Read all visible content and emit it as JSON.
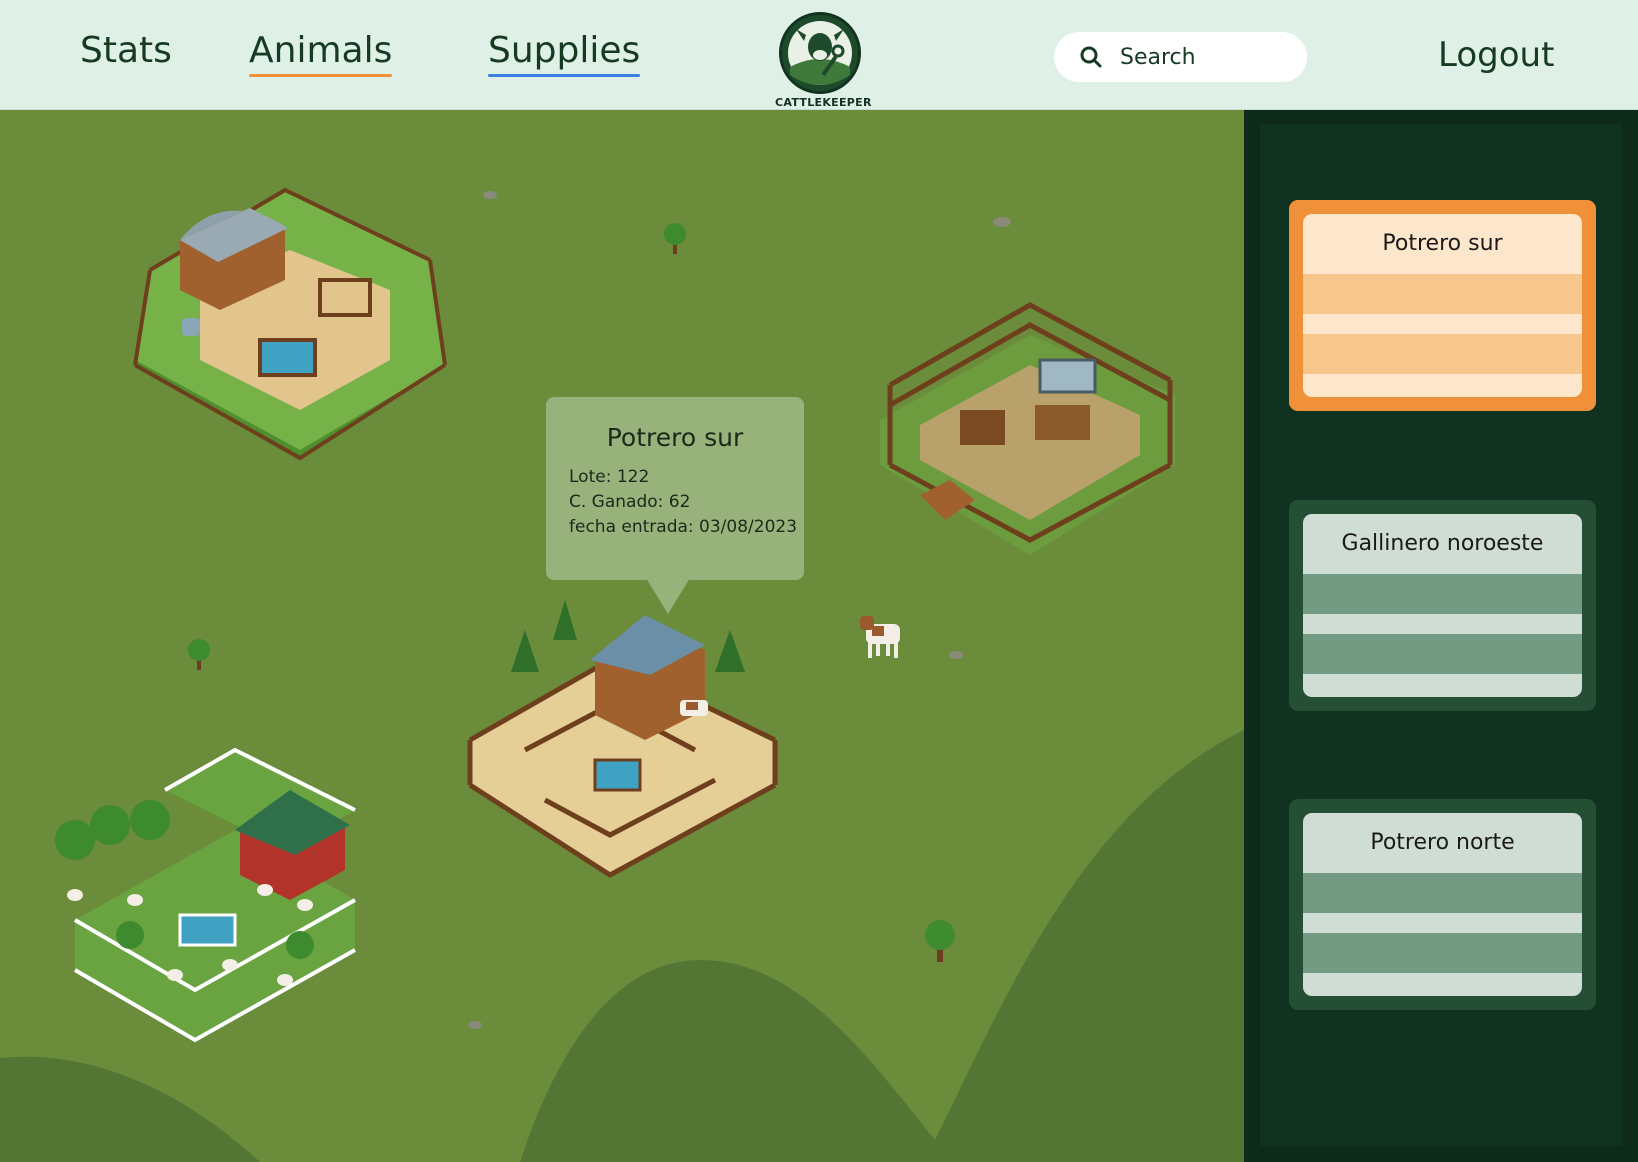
{
  "nav": {
    "stats": "Stats",
    "animals": "Animals",
    "supplies": "Supplies",
    "logout": "Logout"
  },
  "logo": {
    "brand": "CATTLEKEEPER",
    "icon": "cow-wrench-logo"
  },
  "search": {
    "label": "Search",
    "icon": "search-icon"
  },
  "tooltip": {
    "title": "Potrero sur",
    "lote": "Lote: 122",
    "ganado": "C. Ganado: 62",
    "fecha": "fecha entrada: 03/08/2023"
  },
  "farms": [
    {
      "name": "barn-corral-farm"
    },
    {
      "name": "fenced-pen-farm"
    },
    {
      "name": "potrero-sur-farm"
    },
    {
      "name": "sheep-farm"
    }
  ],
  "sidebar": {
    "cards": [
      {
        "title": "Potrero sur",
        "selected": true
      },
      {
        "title": "Gallinero noroeste",
        "selected": false
      },
      {
        "title": "Potrero norte",
        "selected": false
      }
    ]
  },
  "colors": {
    "accent_orange": "#f0913a",
    "accent_blue": "#3b7fe0",
    "grass": "#6a8c3b",
    "sidebar": "#0d2a1a"
  }
}
